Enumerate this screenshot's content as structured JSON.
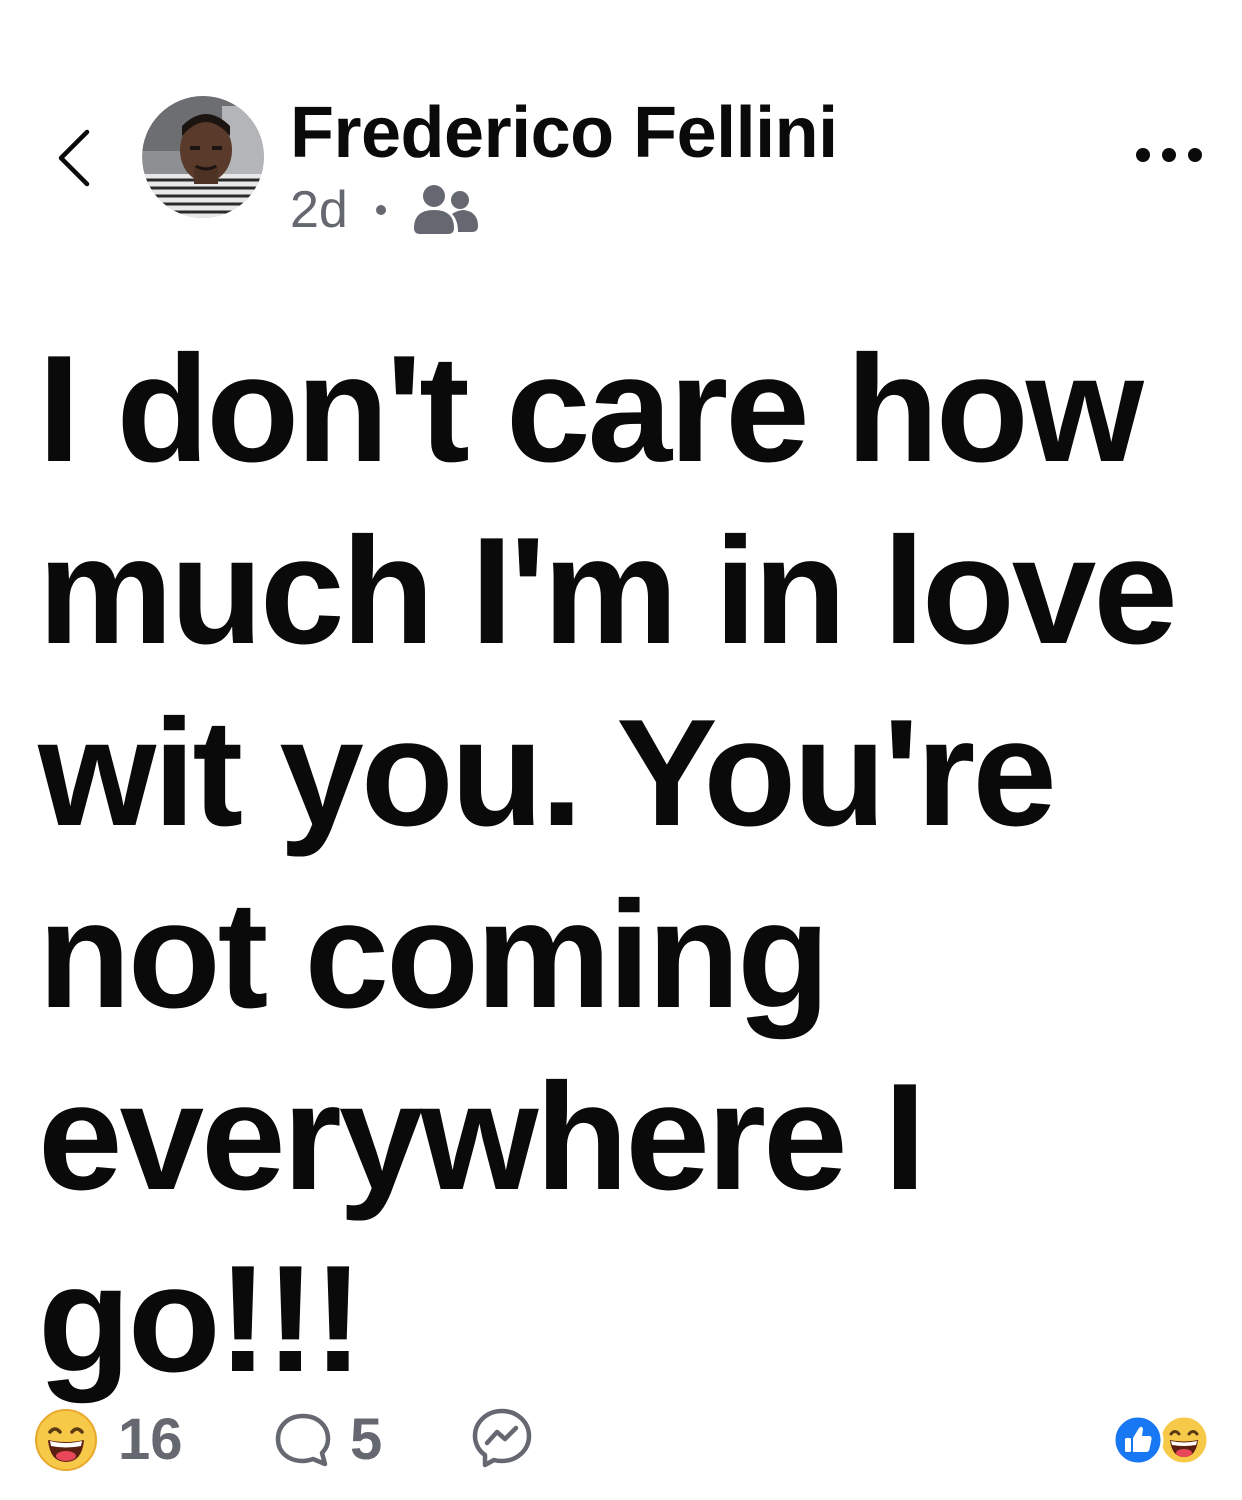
{
  "post": {
    "author_name": "Frederico Fellini",
    "time_ago": "2d",
    "audience_icon": "friends-icon",
    "text": "I don't care how much I'm in love wit you. You're not coming everywhere I go!!!"
  },
  "footer": {
    "reaction_count": "16",
    "comment_count": "5"
  },
  "colors": {
    "text": "#0a0a0a",
    "secondary": "#656870",
    "like_blue": "#1877f2",
    "emoji_yellow": "#f7c948"
  }
}
